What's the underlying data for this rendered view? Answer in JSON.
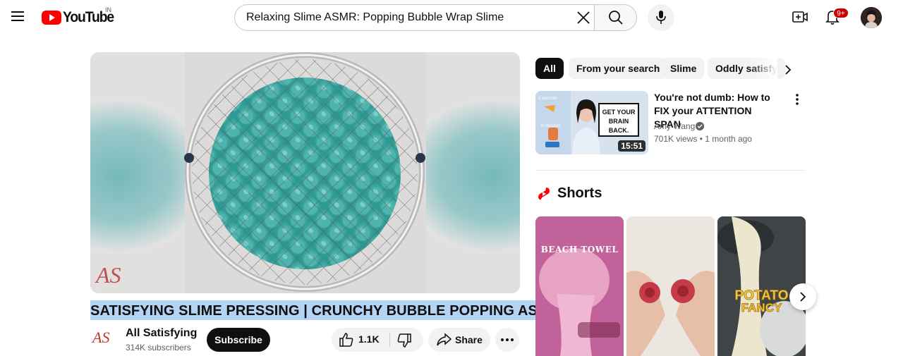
{
  "masthead": {
    "logo_text": "YouTube",
    "country_code": "IN",
    "search_value": "Relaxing Slime ASMR: Popping Bubble Wrap Slime",
    "notification_count": "9+",
    "brand_color": "#ff0000",
    "badge_color": "#cc0000"
  },
  "video": {
    "watermark": "AS",
    "title": "SATISFYING SLIME PRESSING | CRUNCHY BUBBLE POPPING ASMR",
    "channel_name": "All Satisfying",
    "subscribers": "314K subscribers",
    "subscribe_label": "Subscribe",
    "likes": "1.1K",
    "share_label": "Share"
  },
  "chips": [
    "All",
    "From your search",
    "Slime",
    "Oddly satisfy"
  ],
  "recommendation": {
    "title": "You're not dumb: How to FIX your ATTENTION SPAN",
    "channel": "Amy Wang",
    "views": "701K views",
    "age": "1 month ago",
    "duration": "15:51",
    "thumb_text": [
      "GET YOUR",
      "BRAIN",
      "BACK."
    ]
  },
  "shorts": {
    "heading": "Shorts",
    "items": [
      {
        "caption": "BEACH TOWEL"
      },
      {
        "caption": ""
      },
      {
        "caption_line1": "POTATO",
        "caption_line2": "FANCY"
      }
    ]
  },
  "icons": [
    "menu-icon",
    "close-icon",
    "search-icon",
    "mic-icon",
    "create-icon",
    "bell-icon",
    "thumbs-up-icon",
    "thumbs-down-icon",
    "share-icon",
    "more-icon",
    "chevron-right-icon",
    "verified-icon",
    "shorts-icon"
  ]
}
